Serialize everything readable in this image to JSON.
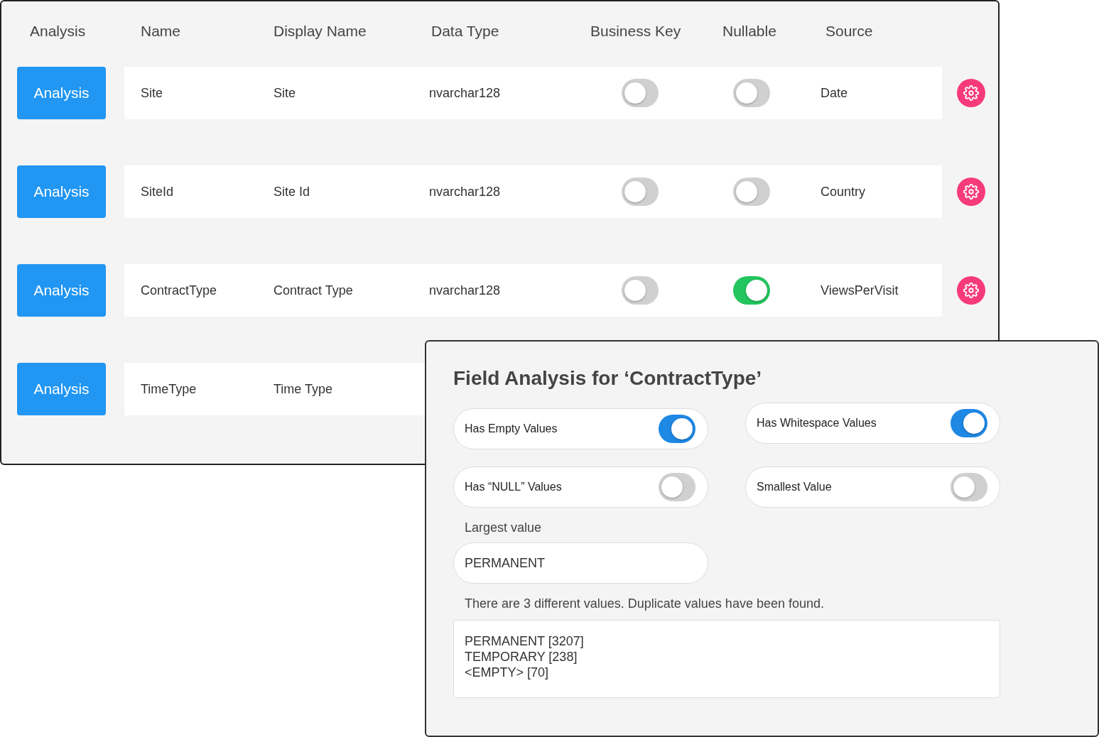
{
  "table": {
    "columns": [
      "Analysis",
      "Name",
      "Display Name",
      "Data Type",
      "Business Key",
      "Nullable",
      "Source"
    ],
    "rows": [
      {
        "button": "Analysis",
        "name": "Site",
        "display_name": "Site",
        "data_type": "nvarchar128",
        "business_key": false,
        "nullable": false,
        "source": "Date"
      },
      {
        "button": "Analysis",
        "name": "SiteId",
        "display_name": "Site Id",
        "data_type": "nvarchar128",
        "business_key": false,
        "nullable": false,
        "source": "Country"
      },
      {
        "button": "Analysis",
        "name": "ContractType",
        "display_name": "Contract Type",
        "data_type": "nvarchar128",
        "business_key": false,
        "nullable": true,
        "source": "ViewsPerVisit"
      },
      {
        "button": "Analysis",
        "name": "TimeType",
        "display_name": "Time Type"
      }
    ]
  },
  "dialog": {
    "title": "Field Analysis for ‘ContractType’",
    "options": [
      {
        "label": "Has Empty Values",
        "on": true
      },
      {
        "label": "Has Whitespace Values",
        "on": true
      },
      {
        "label": "Has “NULL” Values",
        "on": false
      },
      {
        "label": "Smallest Value",
        "on": false
      }
    ],
    "largest_label": "Largest value",
    "largest_value": "PERMANENT",
    "summary": "There are 3 different values. Duplicate values have been found.",
    "values": [
      "PERMANENT [3207]",
      "TEMPORARY [238]",
      "<EMPTY> [70]"
    ]
  }
}
